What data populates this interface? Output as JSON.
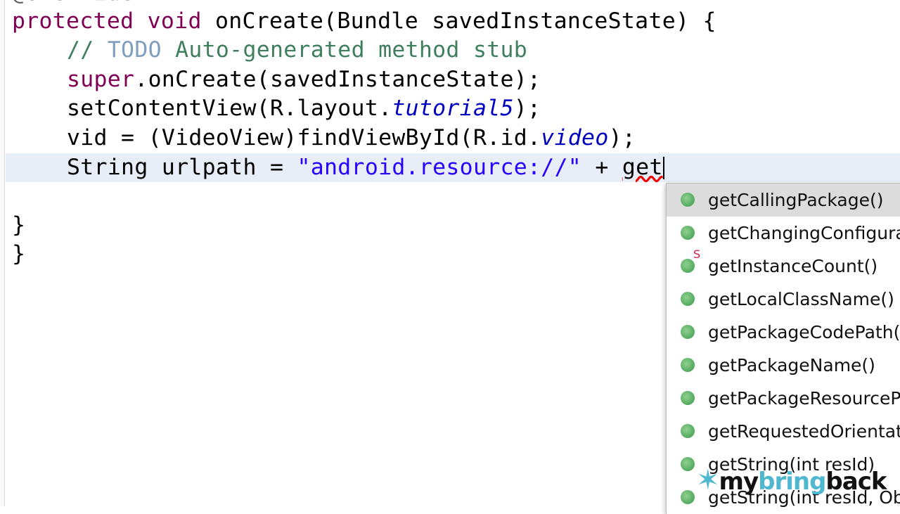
{
  "code": {
    "line0": "@Override",
    "line1": {
      "kw1": "protected",
      "kw2": "void",
      "rest": " onCreate(Bundle savedInstanceState) {"
    },
    "line2": {
      "comment_start": "// ",
      "todo": "TODO",
      "comment_rest": " Auto-generated method stub"
    },
    "line3": {
      "kw": "super",
      "rest": ".onCreate(savedInstanceState);"
    },
    "line4": {
      "pre": "setContentView(R.layout.",
      "field": "tutorial5",
      "post": ");"
    },
    "line5": {
      "pre": "vid = (VideoView)findViewById(R.id.",
      "field": "video",
      "post": ");"
    },
    "line6": {
      "pre": "String urlpath = ",
      "str": "\"android.resource://\"",
      "mid": " + ",
      "typed": "get"
    },
    "line7": "}",
    "line8": "}"
  },
  "autocomplete": {
    "items": [
      {
        "label": "getCallingPackage()",
        "static": ""
      },
      {
        "label": "getChangingConfigurations()",
        "static": ""
      },
      {
        "label": "getInstanceCount()",
        "static": "S"
      },
      {
        "label": "getLocalClassName()",
        "static": ""
      },
      {
        "label": "getPackageCodePath()",
        "static": ""
      },
      {
        "label": "getPackageName()",
        "static": ""
      },
      {
        "label": "getPackageResourcePath()",
        "static": ""
      },
      {
        "label": "getRequestedOrientation()",
        "static": ""
      },
      {
        "label": "getString(int resId)",
        "static": ""
      },
      {
        "label": "getString(int resId, Object... formatArgs)",
        "static": ""
      }
    ]
  },
  "watermark": {
    "part1": "my",
    "part2": "bring",
    "part3": "back"
  }
}
